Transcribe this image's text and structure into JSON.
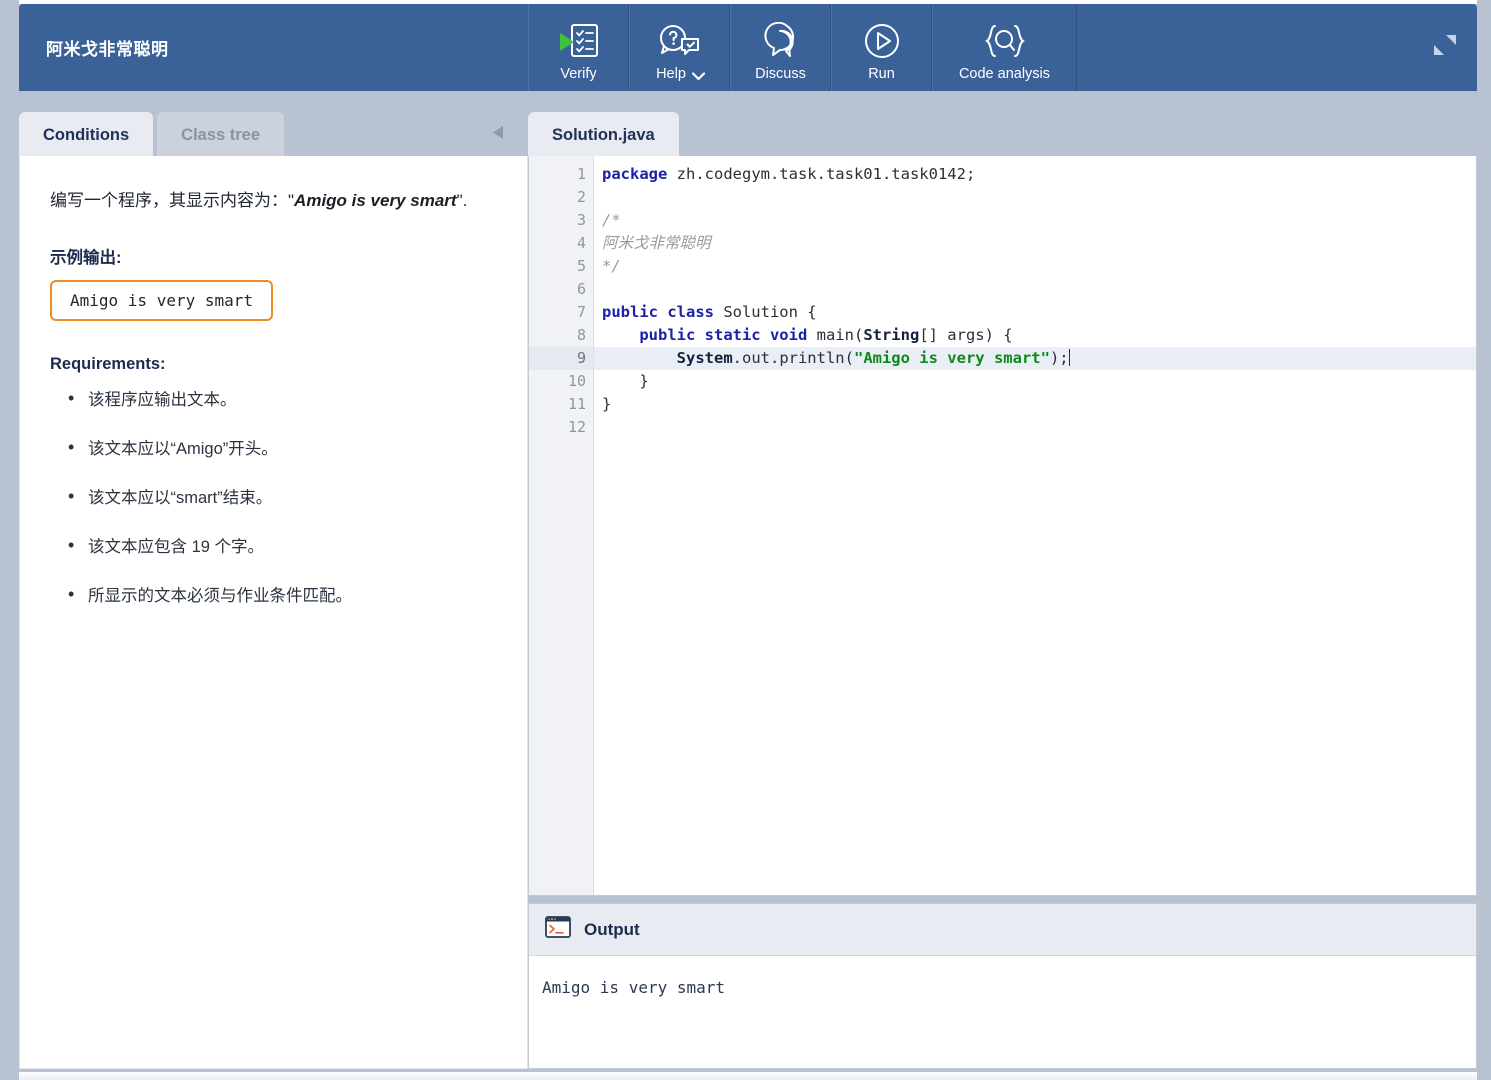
{
  "topbar": {
    "title": "阿米戈非常聪明",
    "tools": [
      {
        "label": "Verify",
        "icon": "verify-checklist-icon"
      },
      {
        "label": "Help",
        "icon": "help-question-icon",
        "chevron": "chevron-down-icon"
      },
      {
        "label": "Discuss",
        "icon": "discuss-speech-bubbles-icon"
      },
      {
        "label": "Run",
        "icon": "run-play-circle-icon"
      },
      {
        "label": "Code analysis",
        "icon": "code-analysis-braces-magnifier-icon"
      }
    ],
    "expand_icon": "expand-collapse-diagonal-icon",
    "accent_color": "#3b6298"
  },
  "left_panel": {
    "tabs": [
      {
        "label": "Conditions",
        "active": true
      },
      {
        "label": "Class tree",
        "active": false
      }
    ],
    "collapse_icon": "collapse-left-arrow-icon",
    "description_prefix": "编写一个程序，其显示内容为：",
    "description_quote_open": "\"",
    "description_emphasis": "Amigo is very smart",
    "description_suffix": "\".",
    "sample_heading": "示例输出:",
    "sample_output": "Amigo is very smart",
    "sample_border_color": "#ef8b23",
    "requirements_heading": "Requirements:",
    "requirements": [
      "该程序应输出文本。",
      "该文本应以“Amigo”开头。",
      "该文本应以“smart”结束。",
      "该文本应包含 19 个字。",
      "所显示的文本必须与作业条件匹配。"
    ]
  },
  "editor": {
    "tab_label": "Solution.java",
    "active_line": 9,
    "line_numbers": [
      "1",
      "2",
      "3",
      "4",
      "5",
      "6",
      "7",
      "8",
      "9",
      "10",
      "11",
      "12"
    ],
    "fold_lines": [
      3,
      7,
      8
    ],
    "lines": [
      {
        "n": 1,
        "tokens": [
          {
            "t": "kw",
            "v": "package"
          },
          {
            "t": "pln",
            "v": " zh.codegym.task.task01.task0142;"
          }
        ]
      },
      {
        "n": 2,
        "tokens": []
      },
      {
        "n": 3,
        "tokens": [
          {
            "t": "cmt",
            "v": "/*"
          }
        ]
      },
      {
        "n": 4,
        "tokens": [
          {
            "t": "cmt",
            "v": "阿米戈非常聪明"
          }
        ]
      },
      {
        "n": 5,
        "tokens": [
          {
            "t": "cmt",
            "v": "*/"
          }
        ]
      },
      {
        "n": 6,
        "tokens": []
      },
      {
        "n": 7,
        "tokens": [
          {
            "t": "kw",
            "v": "public class"
          },
          {
            "t": "pln",
            "v": " Solution {"
          }
        ]
      },
      {
        "n": 8,
        "tokens": [
          {
            "t": "pln",
            "v": "    "
          },
          {
            "t": "kw",
            "v": "public static void"
          },
          {
            "t": "pln",
            "v": " main("
          },
          {
            "t": "typ",
            "v": "String"
          },
          {
            "t": "pln",
            "v": "[] args) {"
          }
        ]
      },
      {
        "n": 9,
        "tokens": [
          {
            "t": "pln",
            "v": "        "
          },
          {
            "t": "typ",
            "v": "System"
          },
          {
            "t": "pln",
            "v": ".out.println("
          },
          {
            "t": "str",
            "v": "\"Amigo is very smart\""
          },
          {
            "t": "pln",
            "v": ");"
          }
        ]
      },
      {
        "n": 10,
        "tokens": [
          {
            "t": "pln",
            "v": "    }"
          }
        ]
      },
      {
        "n": 11,
        "tokens": [
          {
            "t": "pln",
            "v": "}"
          }
        ]
      },
      {
        "n": 12,
        "tokens": []
      }
    ]
  },
  "output": {
    "icon": "terminal-prompt-icon",
    "title": "Output",
    "text": "Amigo is very smart"
  }
}
